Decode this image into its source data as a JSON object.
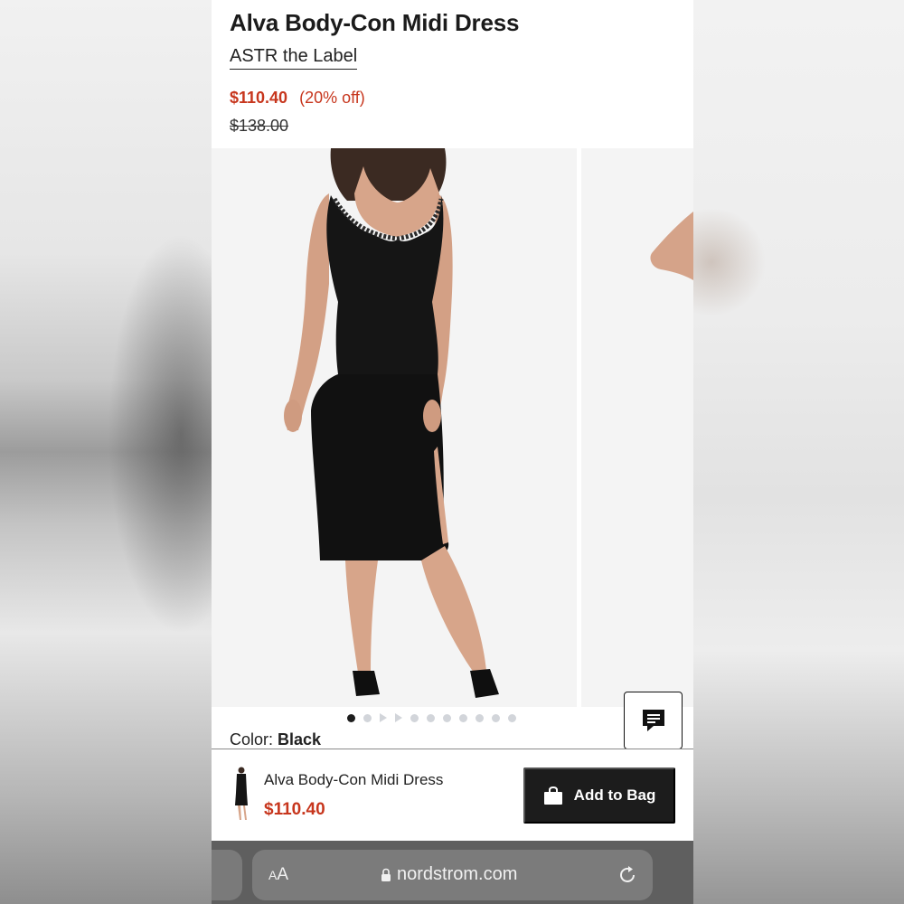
{
  "product": {
    "title": "Alva Body-Con Midi Dress",
    "brand": "ASTR the Label",
    "sale_price": "$110.40",
    "discount": "(20% off)",
    "original_price": "$138.00"
  },
  "gallery": {
    "main_image_alt": "Model wearing black midi dress",
    "active_index": 0
  },
  "color": {
    "label": "Color:",
    "value": "Black"
  },
  "sticky_bar": {
    "name": "Alva Body-Con Midi Dress",
    "price": "$110.40",
    "add_label": "Add to Bag"
  },
  "browser": {
    "aa_small": "A",
    "aa_big": "A",
    "url": "nordstrom.com"
  },
  "icons": {
    "chat": "chat-bubble-icon",
    "bag": "shopping-bag-icon",
    "lock": "lock-icon",
    "reload": "reload-icon"
  },
  "colors": {
    "sale": "#c7361d",
    "button": "#1c1c1c"
  }
}
